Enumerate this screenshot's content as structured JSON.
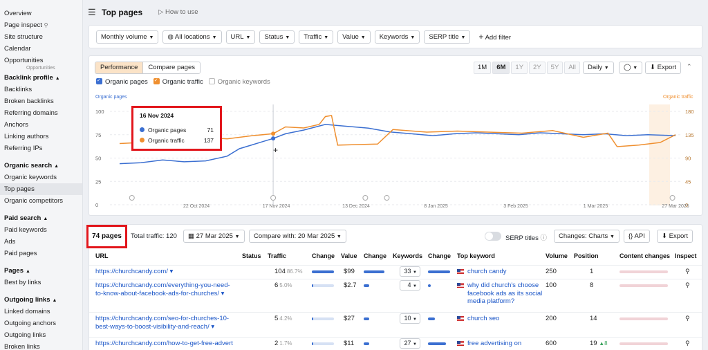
{
  "sidebar": {
    "items_top": [
      "Overview",
      "Page inspect",
      "Site structure",
      "Calendar",
      "Opportunities"
    ],
    "tooltip": "Opportunities",
    "groups": [
      {
        "title": "Backlink profile",
        "items": [
          "Backlinks",
          "Broken backlinks",
          "Referring domains",
          "Anchors",
          "Linking authors",
          "Referring IPs"
        ]
      },
      {
        "title": "Organic search",
        "items": [
          "Organic keywords",
          "Top pages",
          "Organic competitors"
        ]
      },
      {
        "title": "Paid search",
        "items": [
          "Paid keywords",
          "Ads",
          "Paid pages"
        ]
      },
      {
        "title": "Pages",
        "items": [
          "Best by links"
        ]
      },
      {
        "title": "Outgoing links",
        "items": [
          "Linked domains",
          "Outgoing anchors",
          "Outgoing links",
          "Broken links"
        ]
      }
    ]
  },
  "header": {
    "title": "Top pages",
    "howto": "How to use"
  },
  "filters": {
    "buttons": [
      "Monthly volume",
      "All locations",
      "URL",
      "Status",
      "Traffic",
      "Value",
      "Keywords",
      "SERP title"
    ],
    "add": "Add filter"
  },
  "chart_controls": {
    "tabs": [
      "Performance",
      "Compare pages"
    ],
    "periods": [
      "1M",
      "6M",
      "1Y",
      "2Y",
      "5Y",
      "All"
    ],
    "active_period": "6M",
    "granularity": "Daily",
    "export": "Export",
    "legend": [
      "Organic pages",
      "Organic traffic",
      "Organic keywords"
    ],
    "left_axis_title": "Organic pages",
    "right_axis_title": "Organic traffic"
  },
  "colors": {
    "pages": "#3b6fd1",
    "traffic": "#ef8f2f",
    "highlight": "#e2161c"
  },
  "chart_data": {
    "type": "line",
    "x_ticks": [
      "22 Oct 2024",
      "17 Nov 2024",
      "13 Dec 2024",
      "8 Jan 2025",
      "3 Feb 2025",
      "1 Mar 2025",
      "27 Mar 2025"
    ],
    "y_left_ticks": [
      "100",
      "75",
      "50",
      "25",
      "0"
    ],
    "y_right_ticks": [
      "180",
      "135",
      "90",
      "45",
      "0"
    ],
    "ylim_left": [
      0,
      100
    ],
    "ylim_right": [
      0,
      180
    ],
    "series": [
      {
        "name": "Organic pages",
        "axis": "left",
        "x": [
          "2024-09-27",
          "2024-10-04",
          "2024-10-11",
          "2024-10-18",
          "2024-10-25",
          "2024-11-01",
          "2024-11-05",
          "2024-11-09",
          "2024-11-13",
          "2024-11-16",
          "2024-11-20",
          "2024-11-26",
          "2024-12-03",
          "2024-12-10",
          "2024-12-17",
          "2024-12-24",
          "2024-12-31",
          "2025-01-07",
          "2025-01-14",
          "2025-01-21",
          "2025-01-28",
          "2025-02-04",
          "2025-02-11",
          "2025-02-18",
          "2025-02-25",
          "2025-03-04",
          "2025-03-11",
          "2025-03-18",
          "2025-03-27"
        ],
        "values": [
          44,
          45,
          48,
          46,
          47,
          52,
          60,
          64,
          68,
          71,
          76,
          80,
          86,
          84,
          82,
          78,
          76,
          74,
          76,
          77,
          76,
          75,
          77,
          76,
          75,
          76,
          74,
          75,
          74
        ]
      },
      {
        "name": "Organic traffic",
        "axis": "right",
        "x": [
          "2024-09-27",
          "2024-10-04",
          "2024-10-11",
          "2024-10-18",
          "2024-10-25",
          "2024-11-01",
          "2024-11-09",
          "2024-11-16",
          "2024-11-20",
          "2024-11-26",
          "2024-12-01",
          "2024-12-03",
          "2024-12-05",
          "2024-12-07",
          "2024-12-20",
          "2024-12-25",
          "2025-01-05",
          "2025-01-15",
          "2025-01-25",
          "2025-02-05",
          "2025-02-15",
          "2025-02-25",
          "2025-03-05",
          "2025-03-08",
          "2025-03-15",
          "2025-03-22",
          "2025-03-27"
        ],
        "values": [
          118,
          120,
          128,
          132,
          130,
          127,
          133,
          137,
          150,
          148,
          155,
          170,
          172,
          115,
          117,
          145,
          140,
          142,
          140,
          138,
          143,
          130,
          138,
          112,
          115,
          120,
          135
        ]
      }
    ],
    "tooltip": {
      "date": "16 Nov 2024",
      "pages": 71,
      "traffic": 137
    }
  },
  "table_bar": {
    "pages_count": "74 pages",
    "total_traffic": "Total traffic: 120",
    "date": "27 Mar 2025",
    "compare": "Compare with: 20 Mar 2025",
    "serp_titles": "SERP titles",
    "changes": "Changes:  Charts",
    "api": "API",
    "export": "Export"
  },
  "columns": [
    "URL",
    "Status",
    "Traffic",
    "Change",
    "Value",
    "Change",
    "Keywords",
    "Change",
    "Top keyword",
    "Volume",
    "Position",
    "Content changes",
    "Inspect"
  ],
  "rows": [
    {
      "url": "https://churchcandy.com/ ▾",
      "traffic": "104",
      "pct": "86.7%",
      "value": "$99",
      "keywords": "33",
      "top_keyword": "church candy",
      "volume": "250",
      "position": "1",
      "pos_change": "",
      "traffic_bar": 1.0,
      "kw_bar": 1.0
    },
    {
      "url": "https://churchcandy.com/everything-you-need-to-know-about-facebook-ads-for-churches/ ▾",
      "traffic": "6",
      "pct": "5.0%",
      "value": "$2.7",
      "keywords": "4",
      "top_keyword": "why did church's choose facebook ads as its social media platform?",
      "volume": "100",
      "position": "8",
      "pos_change": "",
      "traffic_bar": 0.06,
      "kw_bar": 0.12
    },
    {
      "url": "https://churchcandy.com/seo-for-churches-10-best-ways-to-boost-visibility-and-reach/ ▾",
      "traffic": "5",
      "pct": "4.2%",
      "value": "$27",
      "keywords": "10",
      "top_keyword": "church seo",
      "volume": "200",
      "position": "14",
      "pos_change": "",
      "traffic_bar": 0.05,
      "kw_bar": 0.3
    },
    {
      "url": "https://churchcandy.com/how-to-get-free-advert",
      "traffic": "2",
      "pct": "1.7%",
      "value": "$11",
      "keywords": "27",
      "top_keyword": "free advertising on",
      "volume": "600",
      "position": "19",
      "pos_change": "▲8",
      "traffic_bar": 0.02,
      "kw_bar": 0.8
    }
  ]
}
